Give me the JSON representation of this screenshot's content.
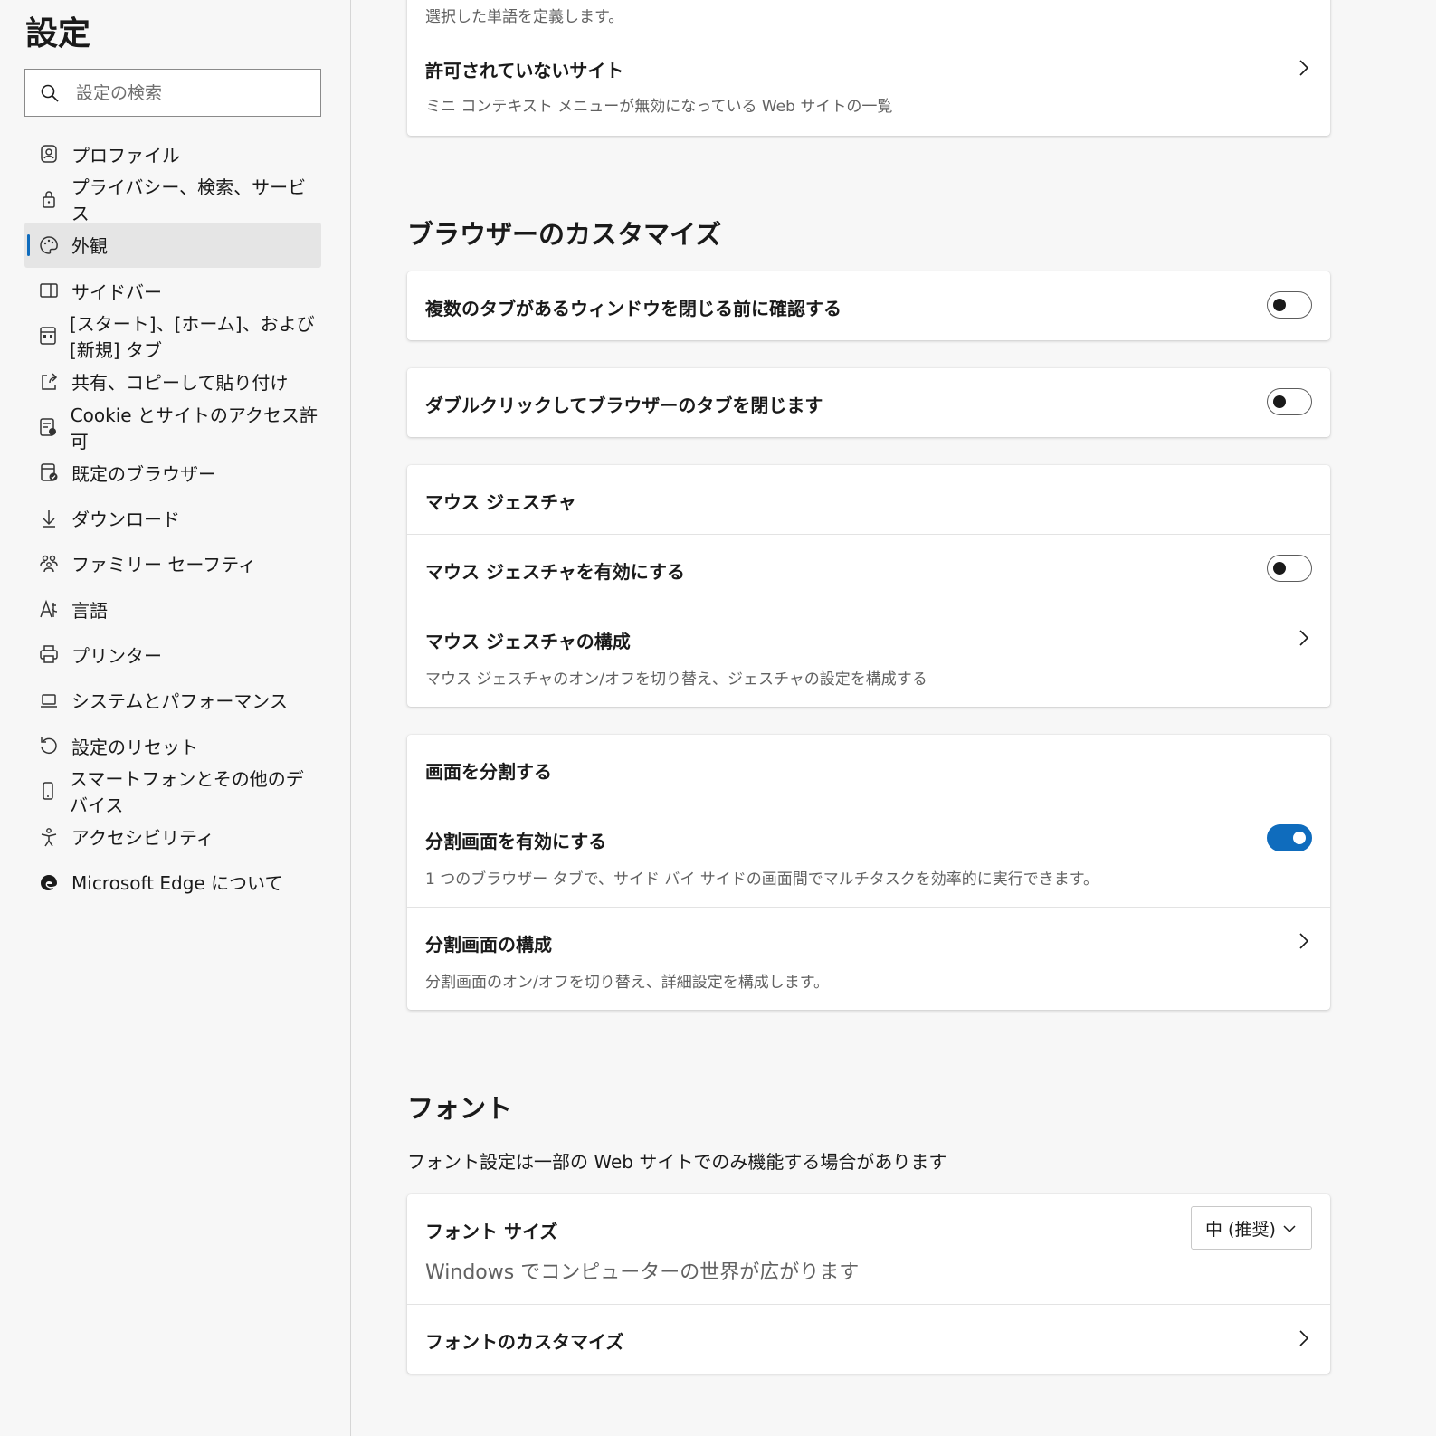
{
  "sidebar": {
    "title": "設定",
    "search_placeholder": "設定の検索",
    "items": [
      {
        "label": "プロファイル",
        "icon": "profile-icon"
      },
      {
        "label": "プライバシー、検索、サービス",
        "icon": "lock-icon"
      },
      {
        "label": "外観",
        "icon": "palette-icon",
        "active": true
      },
      {
        "label": "サイドバー",
        "icon": "sidebar-icon"
      },
      {
        "label": "[スタート]、[ホーム]、および [新規] タブ",
        "icon": "newtab-icon"
      },
      {
        "label": "共有、コピーして貼り付け",
        "icon": "share-icon"
      },
      {
        "label": "Cookie とサイトのアクセス許可",
        "icon": "cookie-permissions-icon"
      },
      {
        "label": "既定のブラウザー",
        "icon": "default-browser-icon"
      },
      {
        "label": "ダウンロード",
        "icon": "download-icon"
      },
      {
        "label": "ファミリー セーフティ",
        "icon": "family-icon"
      },
      {
        "label": "言語",
        "icon": "language-icon"
      },
      {
        "label": "プリンター",
        "icon": "printer-icon"
      },
      {
        "label": "システムとパフォーマンス",
        "icon": "laptop-icon"
      },
      {
        "label": "設定のリセット",
        "icon": "reset-icon"
      },
      {
        "label": "スマートフォンとその他のデバイス",
        "icon": "phone-icon"
      },
      {
        "label": "アクセシビリティ",
        "icon": "accessibility-icon"
      },
      {
        "label": "Microsoft Edge について",
        "icon": "edge-logo-icon"
      }
    ]
  },
  "main": {
    "top_card": {
      "partial_desc": "選択した単語を定義します。",
      "blocked_title": "許可されていないサイト",
      "blocked_desc": "ミニ コンテキスト メニューが無効になっている Web サイトの一覧"
    },
    "browser_customize": {
      "heading": "ブラウザーのカスタマイズ",
      "confirm_close": {
        "label": "複数のタブがあるウィンドウを閉じる前に確認する",
        "enabled": false
      },
      "double_click_close": {
        "label": "ダブルクリックしてブラウザーのタブを閉じます",
        "enabled": false
      },
      "mouse_gesture": {
        "header": "マウス ジェスチャ",
        "enable_label": "マウス ジェスチャを有効にする",
        "enabled": false,
        "configure_title": "マウス ジェスチャの構成",
        "configure_desc": "マウス ジェスチャのオン/オフを切り替え、ジェスチャの設定を構成する"
      },
      "split_screen": {
        "header": "画面を分割する",
        "enable_label": "分割画面を有効にする",
        "enable_desc": "1 つのブラウザー タブで、サイド バイ サイドの画面間でマルチタスクを効率的に実行できます。",
        "enabled": true,
        "configure_title": "分割画面の構成",
        "configure_desc": "分割画面のオン/オフを切り替え、詳細設定を構成します。"
      }
    },
    "fonts": {
      "heading": "フォント",
      "subtitle": "フォント設定は一部の Web サイトでのみ機能する場合があります",
      "size_label": "フォント サイズ",
      "size_preview": "Windows でコンピューターの世界が広がります",
      "size_value": "中 (推奨)",
      "customize_label": "フォントのカスタマイズ"
    }
  },
  "colors": {
    "accent": "#0f6cbd",
    "background": "#f7f7f7",
    "card": "#ffffff"
  }
}
